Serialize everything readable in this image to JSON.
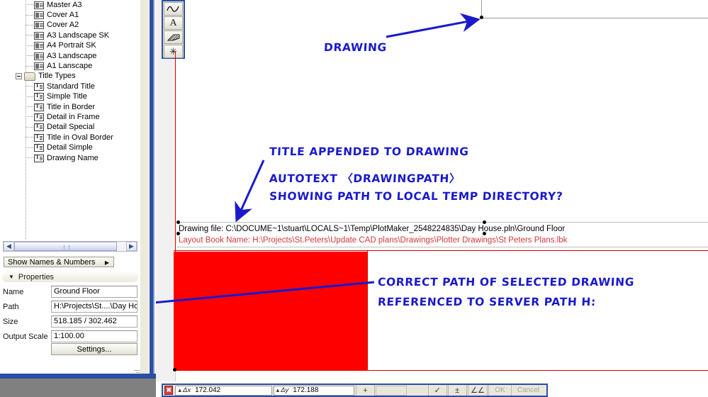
{
  "navigator": {
    "tree_items": [
      {
        "label": "Master A3",
        "icon": "drawing-sheet-icon",
        "type": "sheet",
        "indent": 2
      },
      {
        "label": "Cover A1",
        "icon": "drawing-sheet-icon",
        "type": "sheet",
        "indent": 2
      },
      {
        "label": "Cover A2",
        "icon": "drawing-sheet-icon",
        "type": "sheet",
        "indent": 2
      },
      {
        "label": "A3 Landscape SK",
        "icon": "drawing-sheet-icon",
        "type": "sheet",
        "indent": 2
      },
      {
        "label": "A4 Portrait SK",
        "icon": "drawing-sheet-icon",
        "type": "sheet",
        "indent": 2
      },
      {
        "label": "A3 Landscape",
        "icon": "drawing-sheet-icon",
        "type": "sheet",
        "indent": 2
      },
      {
        "label": "A1 Lanscape",
        "icon": "drawing-sheet-icon",
        "type": "sheet",
        "indent": 2
      },
      {
        "label": "Title Types",
        "icon": "folder-icon",
        "type": "folder",
        "indent": 1
      },
      {
        "label": "Standard Title",
        "icon": "title-type-icon",
        "type": "title",
        "indent": 2
      },
      {
        "label": "Simple Title",
        "icon": "title-type-icon",
        "type": "title",
        "indent": 2
      },
      {
        "label": "Title in Border",
        "icon": "title-type-icon",
        "type": "title",
        "indent": 2
      },
      {
        "label": "Detail in Frame",
        "icon": "title-type-icon",
        "type": "title",
        "indent": 2
      },
      {
        "label": "Detail Special",
        "icon": "title-type-icon",
        "type": "title",
        "indent": 2
      },
      {
        "label": "Title in Oval Border",
        "icon": "title-type-icon",
        "type": "title",
        "indent": 2
      },
      {
        "label": "Detail Simple",
        "icon": "title-type-icon",
        "type": "title",
        "indent": 2
      },
      {
        "label": "Drawing Name",
        "icon": "title-type-icon",
        "type": "title",
        "indent": 2
      }
    ],
    "show_names_button": "Show Names & Numbers",
    "show_names_caret": "▶"
  },
  "properties": {
    "header": "Properties",
    "collapse_triangle": "▼",
    "rows": [
      {
        "label": "Name",
        "value": "Ground Floor"
      },
      {
        "label": "Path",
        "value": "H:\\Projects\\St....\\Day House.pln"
      },
      {
        "label": "Size",
        "value": "518.185 / 302.462"
      },
      {
        "label": "Output Scale",
        "value": "1:100.00"
      }
    ],
    "settings_button": "Settings..."
  },
  "toolbar": {
    "buttons": [
      {
        "name": "polyline-tool",
        "glyph": "∿"
      },
      {
        "name": "text-tool",
        "glyph": "A"
      },
      {
        "name": "fill-tool",
        "glyph": "◢"
      },
      {
        "name": "figure-tool",
        "glyph": "✳"
      }
    ]
  },
  "canvas": {
    "drawing_text_line1": "Drawing file: C:\\DOCUME~1\\stuart\\LOCALS~1\\Temp\\PlotMaker_2548224835\\Day House.pln\\Ground Floor",
    "drawing_text_line2": "Layout Book Name: H:\\Projects\\St.Peters\\Update CAD plans\\Drawings\\Plotter Drawings\\St Peters Plans.lbk"
  },
  "annotations": [
    {
      "name": "annotation-drawing",
      "text": "DRAWING"
    },
    {
      "name": "annotation-title-line1",
      "text": "TITLE APPENDED TO DRAWING"
    },
    {
      "name": "annotation-title-line2",
      "text": "AUTOTEXT 〈DRAWINGPATH〉"
    },
    {
      "name": "annotation-title-line3",
      "text": "SHOWING PATH TO LOCAL TEMP DIRECTORY?"
    },
    {
      "name": "annotation-correct-line1",
      "text": "CORRECT PATH OF SELECTED DRAWING"
    },
    {
      "name": "annotation-correct-line2",
      "text": "REFERENCED TO SERVER PATH H:"
    }
  ],
  "status_bar": {
    "close_glyph": "✖",
    "delta_x_label": "Δx",
    "delta_x_value": "172.042",
    "delta_y_label": "Δy",
    "delta_y_value": "172.188",
    "plus_button": "+",
    "check_button": "✓",
    "plusminus_button": "±",
    "angle_button": "∠∠",
    "ok_button": "OK",
    "cancel_button": "Cancel"
  },
  "colors": {
    "annotation_blue": "#1a1acc",
    "frame_red": "#ff0000",
    "text_red": "#d03a3a",
    "window_blue": "#2b4fa2"
  }
}
